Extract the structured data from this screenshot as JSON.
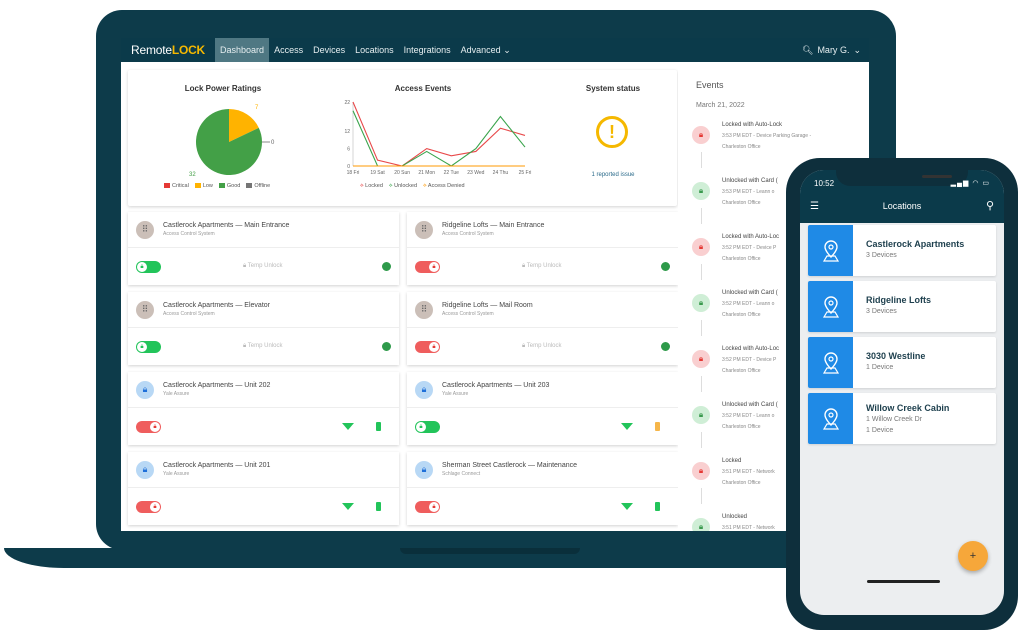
{
  "nav": {
    "logo_prefix": "Remote",
    "logo_suffix": "LOCK",
    "items": [
      "Dashboard",
      "Access",
      "Devices",
      "Locations",
      "Integrations",
      "Advanced"
    ],
    "active": "Dashboard",
    "user": "Mary G."
  },
  "lock_power": {
    "title": "Lock Power Ratings",
    "legend": [
      "Critical",
      "Low",
      "Good",
      "Offline"
    ]
  },
  "access_events": {
    "title": "Access Events",
    "legend": [
      "Locked",
      "Unlocked",
      "Access Denied"
    ]
  },
  "system_status": {
    "title": "System status",
    "issue_text": "1 reported issue"
  },
  "chart_data": [
    {
      "type": "pie",
      "title": "Lock Power Ratings",
      "categories": [
        "Critical",
        "Low",
        "Good",
        "Offline"
      ],
      "values": [
        0,
        7,
        32,
        0
      ],
      "colors": [
        "#e53935",
        "#ffb300",
        "#43a047",
        "#757575"
      ],
      "data_labels": [
        "7",
        "0",
        "32"
      ]
    },
    {
      "type": "line",
      "title": "Access Events",
      "categories": [
        "18 Fri",
        "19 Sat",
        "20 Sun",
        "21 Mon",
        "22 Tue",
        "23 Wed",
        "24 Thu",
        "25 Fri"
      ],
      "yticks": [
        0,
        6,
        12,
        22
      ],
      "ylim": [
        0,
        22
      ],
      "series": [
        {
          "name": "Locked",
          "color": "#e8494a",
          "values": [
            22,
            2,
            0,
            6,
            3.5,
            5,
            13,
            10.5
          ]
        },
        {
          "name": "Unlocked",
          "color": "#3aa44c",
          "values": [
            19,
            0,
            0,
            5,
            0,
            6,
            17,
            6.5
          ]
        },
        {
          "name": "Access Denied",
          "color": "#ff9800",
          "values": [
            0,
            0,
            0,
            0,
            0,
            0,
            0,
            0
          ]
        }
      ]
    }
  ],
  "cards": [
    {
      "title": "Castlerock Apartments — Main Entrance",
      "sub": "Access Control System",
      "type": "keypad",
      "locked": false,
      "temp": "Temp Unlock"
    },
    {
      "title": "Ridgeline Lofts — Main Entrance",
      "sub": "Access Control System",
      "type": "keypad",
      "locked": true,
      "temp": "Temp Unlock"
    },
    {
      "title": "Castlerock Apartments — Elevator",
      "sub": "Access Control System",
      "type": "keypad",
      "locked": false,
      "temp": "Temp Unlock"
    },
    {
      "title": "Ridgeline Lofts — Mail Room",
      "sub": "Access Control System",
      "type": "keypad",
      "locked": true,
      "temp": "Temp Unlock"
    },
    {
      "title": "Castlerock Apartments — Unit 202",
      "sub": "Yale Assure",
      "type": "lock",
      "locked": true,
      "battery": "good"
    },
    {
      "title": "Castlerock Apartments — Unit 203",
      "sub": "Yale Assure",
      "type": "lock",
      "locked": false,
      "battery": "low"
    },
    {
      "title": "Castlerock Apartments — Unit 201",
      "sub": "Yale Assure",
      "type": "lock",
      "locked": true,
      "battery": "good"
    },
    {
      "title": "Sherman Street Castlerock — Maintenance",
      "sub": "Schlage Connect",
      "type": "lock",
      "locked": true,
      "battery": "good"
    }
  ],
  "events": {
    "title": "Events",
    "date": "March 21, 2022",
    "items": [
      {
        "title": "Locked with Auto-Lock",
        "detail": "3:53 PM EDT - Device Parking Garage -",
        "office": "Charleston Office",
        "status": "locked"
      },
      {
        "title": "Unlocked with Card (",
        "detail": "3:53 PM EDT - Leann o",
        "office": "Charleston Office",
        "status": "unlocked"
      },
      {
        "title": "Locked with Auto-Loc",
        "detail": "3:52 PM EDT - Device P",
        "office": "Charleston Office",
        "status": "locked"
      },
      {
        "title": "Unlocked with Card (",
        "detail": "3:52 PM EDT - Leann o",
        "office": "Charleston Office",
        "status": "unlocked"
      },
      {
        "title": "Locked with Auto-Loc",
        "detail": "3:52 PM EDT - Device P",
        "office": "Charleston Office",
        "status": "locked"
      },
      {
        "title": "Unlocked with Card (",
        "detail": "3:52 PM EDT - Leann o",
        "office": "Charleston Office",
        "status": "unlocked"
      },
      {
        "title": "Locked",
        "detail": "3:51 PM EDT - Network",
        "office": "Charleston Office",
        "status": "locked"
      },
      {
        "title": "Unlocked",
        "detail": "3:51 PM EDT - Network",
        "office": "",
        "status": "unlocked"
      }
    ]
  },
  "phone": {
    "time": "10:52",
    "title": "Locations",
    "locations": [
      {
        "name": "Castlerock Apartments",
        "lines": [
          "3 Devices"
        ]
      },
      {
        "name": "Ridgeline Lofts",
        "lines": [
          "3 Devices"
        ]
      },
      {
        "name": "3030 Westline",
        "lines": [
          "1 Device"
        ]
      },
      {
        "name": "Willow Creek Cabin",
        "lines": [
          "1 Willow Creek Dr",
          "1 Device"
        ]
      }
    ],
    "fab": "+"
  },
  "colors": {
    "brand": "#0b3a4a",
    "accent": "#f5b800",
    "locked": "#ef5d5d",
    "unlocked": "#22c45a",
    "pin": "#1f8ae6",
    "fab": "#f6a73a"
  }
}
